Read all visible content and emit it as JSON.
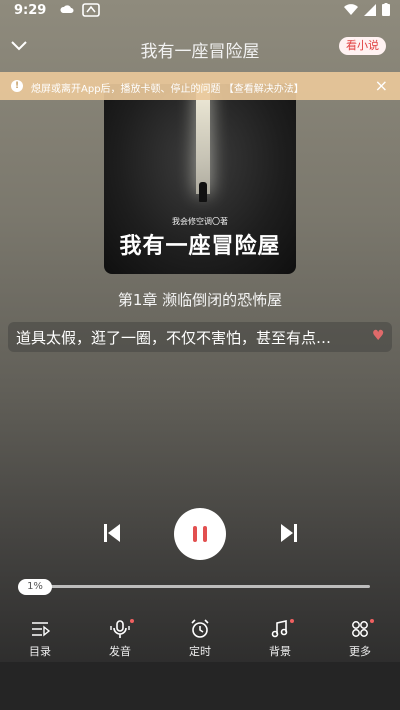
{
  "status": {
    "time": "9:29"
  },
  "header": {
    "title": "我有一座冒险屋",
    "novel_button": "看小说"
  },
  "notice": {
    "icon_glyph": "!",
    "text": "熄屏或离开App后，播放卡顿、停止的问题 【查看解决办法】",
    "close": "×"
  },
  "cover": {
    "author": "我会修空调〇著",
    "title": "我有一座冒险屋"
  },
  "chapter": {
    "title": "第1章 濒临倒闭的恐怖屋"
  },
  "current_text": "道具太假，逛了一圈，不仅不害怕，甚至有点…",
  "heart": "♥",
  "progress": {
    "label": "1%",
    "fraction": 0.01
  },
  "toolbar": {
    "items": [
      {
        "label": "目录"
      },
      {
        "label": "发音"
      },
      {
        "label": "定时"
      },
      {
        "label": "背景"
      },
      {
        "label": "更多"
      }
    ]
  },
  "colors": {
    "accent": "#e25050",
    "notice_bg": "#e9c89a"
  }
}
